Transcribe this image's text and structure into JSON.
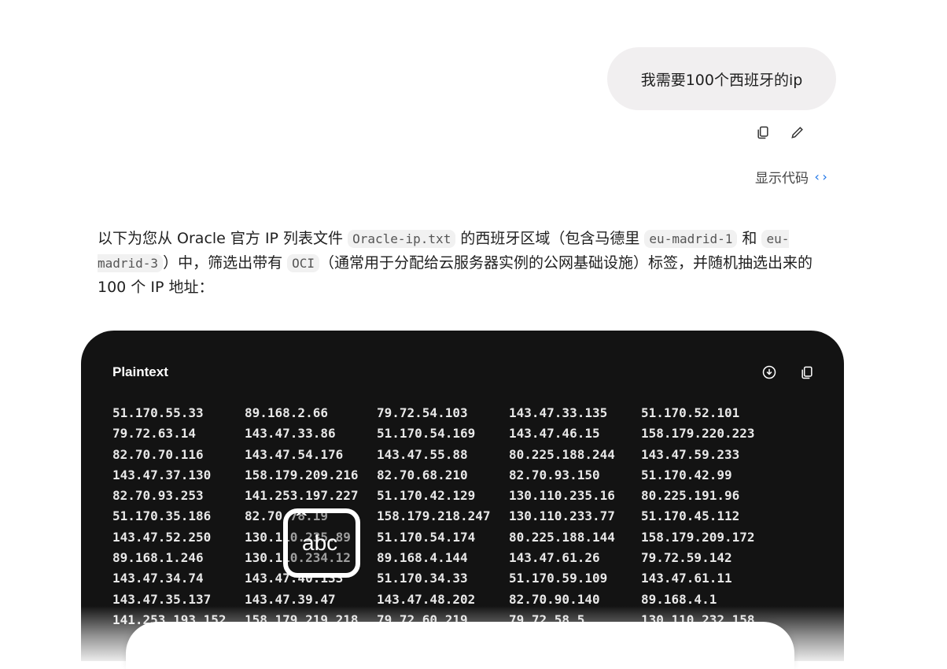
{
  "user_message": {
    "text": "我需要100个西班牙的ip"
  },
  "message_actions": {
    "copy_icon": "copy-icon",
    "edit_icon": "edit-icon"
  },
  "show_code": {
    "label": "显示代码",
    "chevron": "‹›"
  },
  "response": {
    "p1": "以下为您从 Oracle 官方 IP 列表文件 ",
    "code1": "Oracle-ip.txt",
    "p2": " 的西班牙区域（包含马德里 ",
    "code2": "eu-madrid-1",
    "p3": " 和 ",
    "code3": "eu-madrid-3",
    "p4": "）中，筛选出带有 ",
    "code4": "OCI",
    "p5": "（通常用于分配给云服务器实例的公网基础设施）标签，并随机抽选出来的 100 个 IP 地址："
  },
  "code_block": {
    "language": "Plaintext",
    "download_icon": "download-icon",
    "copy_icon": "copy-icon",
    "rows": [
      [
        "51.170.55.33",
        "89.168.2.66",
        "79.72.54.103",
        "143.47.33.135",
        "51.170.52.101"
      ],
      [
        "79.72.63.14",
        "143.47.33.86",
        "51.170.54.169",
        "143.47.46.15",
        "158.179.220.223"
      ],
      [
        "82.70.70.116",
        "143.47.54.176",
        "143.47.55.88",
        "80.225.188.244",
        "143.47.59.233"
      ],
      [
        "143.47.37.130",
        "158.179.209.216",
        "82.70.68.210",
        "82.70.93.150",
        "51.170.42.99"
      ],
      [
        "82.70.93.253",
        "141.253.197.227",
        "51.170.42.129",
        "130.110.235.16",
        "80.225.191.96"
      ],
      [
        "51.170.35.186",
        "82.70.78.19",
        "158.179.218.247",
        "130.110.233.77",
        "51.170.45.112"
      ],
      [
        "143.47.52.250",
        "130.110.235.89",
        "51.170.54.174",
        "80.225.188.144",
        "158.179.209.172"
      ],
      [
        "89.168.1.246",
        "130.110.234.12",
        "89.168.4.144",
        "143.47.61.26",
        "79.72.59.142"
      ],
      [
        "143.47.34.74",
        "143.47.40.133",
        "51.170.34.33",
        "51.170.59.109",
        "143.47.61.11"
      ],
      [
        "143.47.35.137",
        "143.47.39.47",
        "143.47.48.202",
        "82.70.90.140",
        "89.168.4.1"
      ],
      [
        "141.253.193.152",
        "158.179.219.218",
        "79.72.60.219",
        "79.72.58.5",
        "130.110.232.158"
      ]
    ]
  },
  "overlay": {
    "icon": "keyboard-abc-icon",
    "text": "abc",
    "caret": "^"
  }
}
